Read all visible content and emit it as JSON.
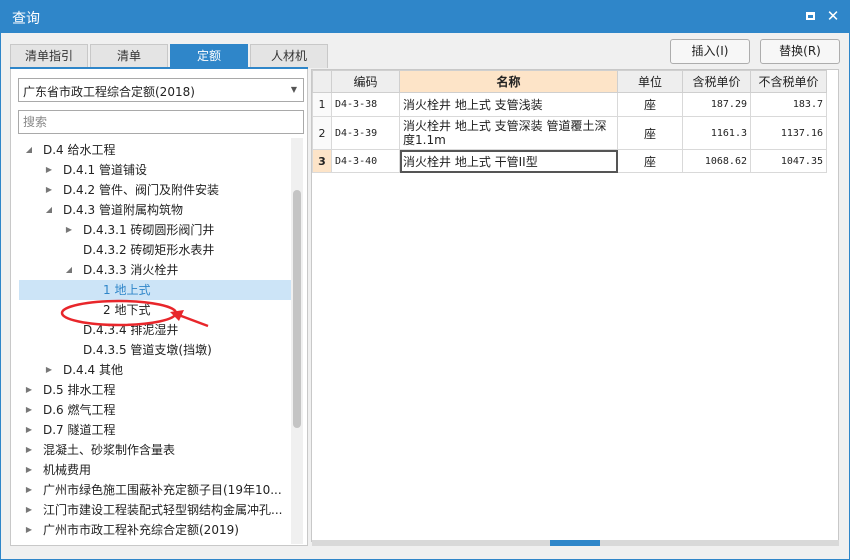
{
  "window": {
    "title": "查询"
  },
  "tabs": [
    {
      "label": "清单指引"
    },
    {
      "label": "清单"
    },
    {
      "label": "定额"
    },
    {
      "label": "人材机"
    }
  ],
  "buttons": {
    "insert": "插入(I)",
    "replace": "替换(R)"
  },
  "library": {
    "selected": "广东省市政工程综合定额(2018)"
  },
  "search": {
    "placeholder": "搜索"
  },
  "tree": [
    {
      "label": "D.4 给水工程",
      "state": "expanded"
    },
    {
      "label": "D.4.1 管道铺设",
      "state": "collapsed"
    },
    {
      "label": "D.4.2 管件、阀门及附件安装",
      "state": "collapsed"
    },
    {
      "label": "D.4.3 管道附属构筑物",
      "state": "expanded"
    },
    {
      "label": "D.4.3.1 砖砌圆形阀门井",
      "state": "collapsed"
    },
    {
      "label": "D.4.3.2 砖砌矩形水表井",
      "state": "leaf"
    },
    {
      "label": "D.4.3.3 消火栓井",
      "state": "expanded"
    },
    {
      "label": "1 地上式",
      "state": "leaf",
      "selected": true
    },
    {
      "label": "2 地下式",
      "state": "leaf"
    },
    {
      "label": "D.4.3.4 排泥湿井",
      "state": "leaf"
    },
    {
      "label": "D.4.3.5 管道支墩(挡墩)",
      "state": "leaf"
    },
    {
      "label": "D.4.4 其他",
      "state": "collapsed"
    },
    {
      "label": "D.5 排水工程",
      "state": "collapsed"
    },
    {
      "label": "D.6 燃气工程",
      "state": "collapsed"
    },
    {
      "label": "D.7 隧道工程",
      "state": "collapsed"
    },
    {
      "label": "混凝土、砂浆制作含量表",
      "state": "collapsed"
    },
    {
      "label": "机械费用",
      "state": "collapsed"
    },
    {
      "label": "广州市绿色施工围蔽补充定额子目(19年10...",
      "state": "collapsed"
    },
    {
      "label": "江门市建设工程装配式轻型钢结构金属冲孔...",
      "state": "collapsed"
    },
    {
      "label": "广州市市政工程补充综合定额(2019)",
      "state": "collapsed"
    }
  ],
  "table": {
    "columns": [
      "",
      "编码",
      "名称",
      "单位",
      "含税单价",
      "不含税单价"
    ],
    "rows": [
      {
        "no": "1",
        "code": "D4-3-38",
        "name": "消火栓井 地上式 支管浅装",
        "unit": "座",
        "price_tax": "187.29",
        "price_notax": "183.7"
      },
      {
        "no": "2",
        "code": "D4-3-39",
        "name": "消火栓井 地上式 支管深装 管道覆土深度1.1m",
        "unit": "座",
        "price_tax": "1161.3",
        "price_notax": "1137.16"
      },
      {
        "no": "3",
        "code": "D4-3-40",
        "name": "消火栓井 地上式 干管II型",
        "unit": "座",
        "price_tax": "1068.62",
        "price_notax": "1047.35"
      }
    ]
  },
  "colors": {
    "accent": "#2f86c9",
    "annotation": "#e8262b",
    "header_highlight": "#fde4c8"
  }
}
